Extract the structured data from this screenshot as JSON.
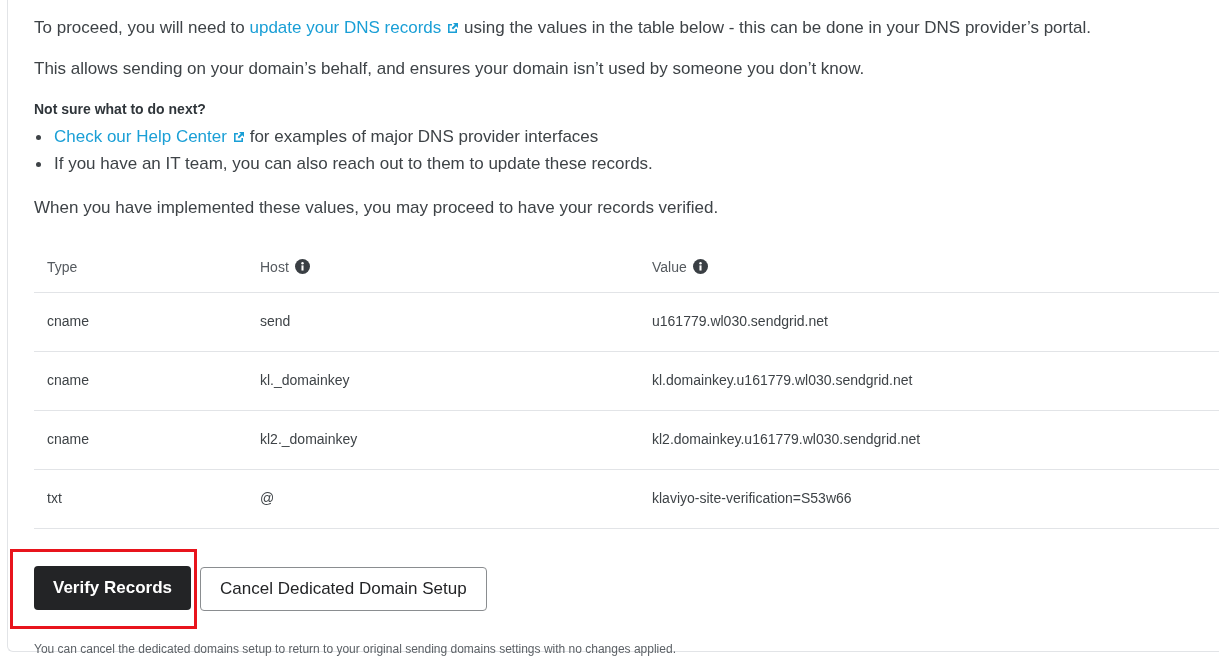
{
  "intro": [
    {
      "kind": "text",
      "text": "To proceed, you will need to"
    },
    {
      "kind": "link",
      "text": "update your DNS records"
    },
    {
      "kind": "text",
      "text": "using the values in the table below - this can be done in your DNS provider’s portal."
    }
  ],
  "purpose": "This allows sending on your domain’s behalf, and ensures your domain isn’t used by someone you don’t know.",
  "help_heading": "Not sure what to do next?",
  "help_items": [
    [
      {
        "kind": "link",
        "text": "Check our Help Center"
      },
      {
        "kind": "text",
        "text": "for examples of major DNS provider interfaces"
      }
    ],
    [
      {
        "kind": "text",
        "text": "If you have an IT team, you can also reach out to them to update these records."
      }
    ]
  ],
  "after": "When you have implemented these values, you may proceed to have your records verified.",
  "table": {
    "columns": [
      {
        "label": "Type",
        "info": false
      },
      {
        "label": "Host",
        "info": true
      },
      {
        "label": "Value",
        "info": true
      }
    ],
    "rows": [
      [
        "cname",
        "send",
        "u161779.wl030.sendgrid.net"
      ],
      [
        "cname",
        "kl._domainkey",
        "kl.domainkey.u161779.wl030.sendgrid.net"
      ],
      [
        "cname",
        "kl2._domainkey",
        "kl2.domainkey.u161779.wl030.sendgrid.net"
      ],
      [
        "txt",
        "@",
        "klaviyo-site-verification=S53w66"
      ]
    ]
  },
  "buttons": [
    {
      "label": "Verify Records",
      "kind": "primary",
      "highlighted": true
    },
    {
      "label": "Cancel Dedicated Domain Setup",
      "kind": "secondary",
      "highlighted": false
    }
  ],
  "footnote": "You can cancel the dedicated domains setup to return to your original sending domains settings with no changes applied."
}
